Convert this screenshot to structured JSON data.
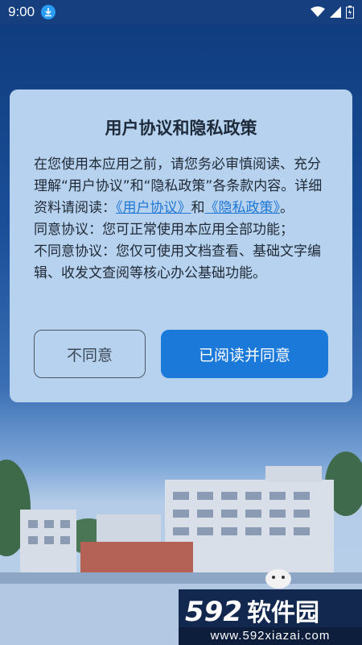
{
  "status_bar": {
    "time": "9:00",
    "icons": [
      "download-icon",
      "wifi-icon",
      "signal-icon",
      "battery-icon"
    ]
  },
  "dialog": {
    "title": "用户协议和隐私政策",
    "body_line1_pre": "在您使用本应用之前，请您务必审慎阅读、充分理解“用户协议”和“隐私政策”各条款内容。详细资料请阅读：",
    "link_user_agreement": "《用户协议》",
    "and": "和",
    "link_privacy_policy": "《隐私政策》",
    "period": "。",
    "agree_note": "同意协议：您可正常使用本应用全部功能；",
    "disagree_note": "不同意协议：您仅可使用文档查看、基础文字编辑、收发文查阅等核心办公基础功能。",
    "disagree_button": "不同意",
    "agree_button": "已阅读并同意"
  },
  "colors": {
    "accent": "#1b79d9",
    "link": "#1f78d4",
    "dialog_bg": "#b7d2ee"
  },
  "watermark": {
    "number": "592",
    "name": "软件园",
    "url": "www.592xiazai.com"
  }
}
